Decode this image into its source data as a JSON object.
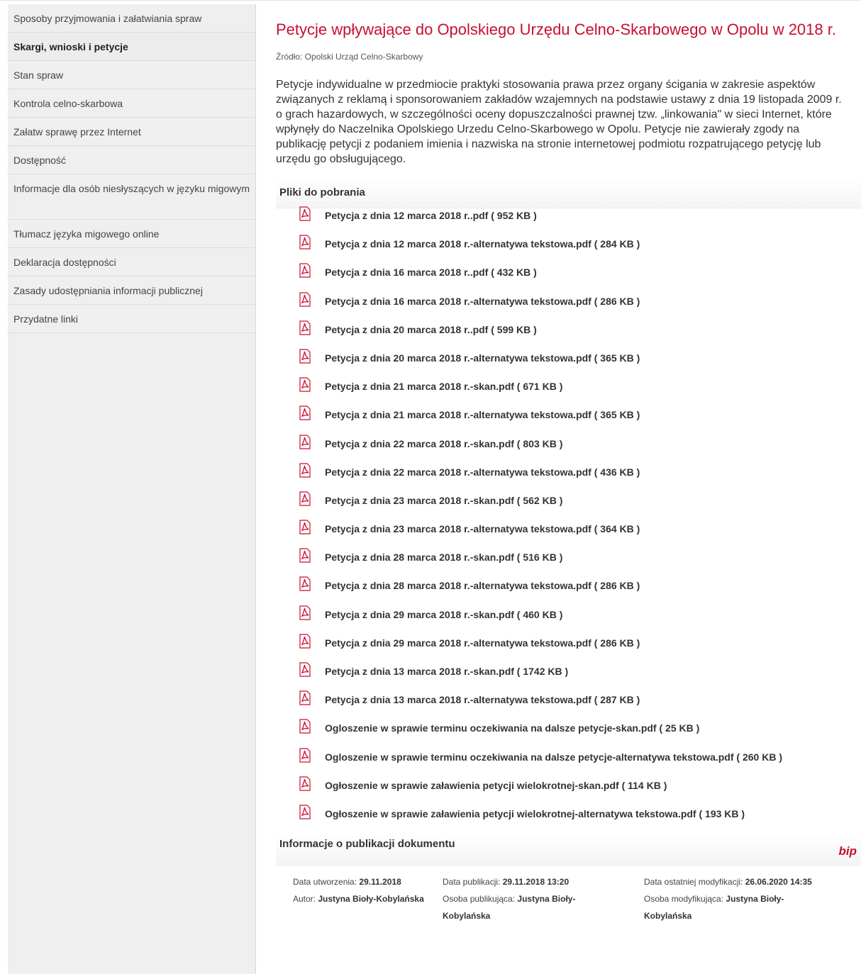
{
  "sidebar": {
    "items": [
      {
        "label": "Sposoby przyjmowania i załatwiania spraw",
        "active": false
      },
      {
        "label": "Skargi, wnioski i petycje",
        "active": true
      },
      {
        "label": "Stan spraw",
        "active": false
      },
      {
        "label": "Kontrola celno-skarbowa",
        "active": false
      },
      {
        "label": "Załatw sprawę przez Internet",
        "active": false
      },
      {
        "label": "Dostępność",
        "active": false
      },
      {
        "label": "Informacje dla osób niesłyszących w języku migowym",
        "active": false
      },
      {
        "label": "Tłumacz języka migowego online",
        "active": false
      },
      {
        "label": "Deklaracja dostępności",
        "active": false
      },
      {
        "label": "Zasady udostępniania informacji publicznej",
        "active": false
      },
      {
        "label": "Przydatne linki",
        "active": false
      }
    ]
  },
  "article": {
    "title": "Petycje wpływające do Opolskiego Urzędu Celno-Skarbowego w Opolu w 2018 r.",
    "source": "Źródło: Opolski Urząd Celno-Skarbowy",
    "lead": "Petycje indywidualne w przedmiocie praktyki stosowania prawa przez organy ścigania w zakresie aspektów związanych z reklamą i sponsorowaniem zakładów wzajemnych na podstawie ustawy z dnia 19 listopada 2009 r. o grach hazardowych, w szczególności oceny dopuszczalności prawnej tzw. „linkowania\" w sieci Internet, które  wpłynęły  do Naczelnika Opolskiego Urzedu Celno-Skarbowego w Opolu. Petycje nie zawierały zgody na publikację petycji z podaniem imienia i nazwiska na stronie internetowej podmiotu rozpatrującego petycję lub urzędu go obsługującego."
  },
  "downloads": {
    "heading": "Pliki do pobrania",
    "files": [
      "Petycja z dnia 12 marca 2018 r..pdf ( 952 KB )",
      "Petycja z dnia 12 marca 2018 r.-alternatywa tekstowa.pdf ( 284 KB )",
      "Petycja z dnia 16 marca 2018 r..pdf ( 432 KB )",
      "Petycja z dnia 16 marca 2018 r.-alternatywa tekstowa.pdf ( 286 KB )",
      "Petycja z dnia 20 marca 2018 r..pdf ( 599 KB )",
      "Petycja z dnia 20 marca 2018 r.-alternatywa tekstowa.pdf ( 365 KB )",
      "Petycja z dnia 21 marca 2018 r.-skan.pdf ( 671 KB )",
      "Petycja z dnia 21 marca 2018 r.-alternatywa tekstowa.pdf ( 365 KB )",
      "Petycja z dnia 22 marca 2018 r.-skan.pdf ( 803 KB )",
      "Petycja z dnia 22 marca 2018 r.-alternatywa tekstowa.pdf ( 436 KB )",
      "Petycja z dnia 23 marca 2018 r.-skan.pdf ( 562 KB )",
      "Petycja z dnia 23 marca 2018 r.-alternatywa tekstowa.pdf ( 364 KB )",
      "Petycja z dnia 28 marca 2018 r.-skan.pdf ( 516 KB )",
      "Petycja z dnia 28 marca 2018 r.-alternatywa tekstowa.pdf ( 286 KB )",
      "Petycja z dnia 29 marca 2018 r.-skan.pdf ( 460 KB )",
      "Petycja z dnia 29 marca 2018 r.-alternatywa tekstowa.pdf ( 286 KB )",
      "Petycja z dnia 13 marca 2018 r.-skan.pdf ( 1742 KB )",
      "Petycja z dnia 13 marca 2018 r.-alternatywa tekstowa.pdf ( 287 KB )",
      "Ogloszenie w sprawie terminu oczekiwania na dalsze petycje-skan.pdf ( 25 KB )",
      "Ogloszenie w sprawie terminu oczekiwania na dalsze petycje-alternatywa tekstowa.pdf ( 260 KB )",
      "Ogłoszenie w sprawie załawienia petycji wielokrotnej-skan.pdf ( 114 KB )",
      "Ogłoszenie w sprawie załawienia petycji wielokrotnej-alternatywa tekstowa.pdf ( 193 KB )"
    ]
  },
  "publication": {
    "heading": "Informacje o publikacji dokumentu",
    "logo": "bip",
    "created_label": "Data utworzenia:",
    "created_value": "29.11.2018",
    "published_label": "Data publikacji:",
    "published_value": "29.11.2018 13:20",
    "modified_label": "Data ostatniej modyfikacji:",
    "modified_value": "26.06.2020 14:35",
    "author_label": "Autor:",
    "author_value": "Justyna Bioły-Kobylańska",
    "publisher_label": "Osoba publikująca:",
    "publisher_value": "Justyna Bioły-Kobylańska",
    "modifier_label": "Osoba modyfikująca:",
    "modifier_value": "Justyna Bioły-Kobylańska"
  },
  "colors": {
    "accent": "#c8102e",
    "sidebar_bg": "#efefef"
  }
}
